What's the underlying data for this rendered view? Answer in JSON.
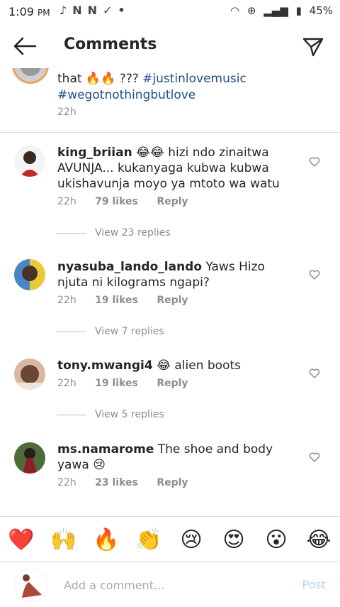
{
  "status_bar": {
    "time": "1:09",
    "ampm": "PM",
    "battery": "45%",
    "left_icons": [
      "music-note-icon",
      "n-notification-icon",
      "n-notification-icon",
      "download-done-icon",
      "dot-icon"
    ],
    "right_icons": [
      "headphones-icon",
      "data-saver-icon",
      "signal-icon",
      "battery-icon"
    ]
  },
  "header": {
    "title": "Comments",
    "back_icon": "back-arrow-icon",
    "send_icon": "send-icon"
  },
  "caption": {
    "text_prefix": "that 🔥🔥 ??? ",
    "hashtag1": "#justinlovemusic",
    "hashtag2": "#wegotnothingbutlove",
    "time": "22h"
  },
  "comments": [
    {
      "username": "king_briian",
      "text": "😂😂 hizi ndo zinaitwa AVUNJA... kukanyaga kubwa kubwa ukishavunja moyo ya mtoto wa watu",
      "time": "22h",
      "likes": "79 likes",
      "reply": "Reply",
      "view_replies": "View 23 replies"
    },
    {
      "username": "nyasuba_lando_lando",
      "text": "Yaws Hizo njuta ni kilograms ngapi?",
      "time": "22h",
      "likes": "19 likes",
      "reply": "Reply",
      "view_replies": "View 7 replies"
    },
    {
      "username": "tony.mwangi4",
      "text": "😂 alien boots",
      "time": "22h",
      "likes": "19 likes",
      "reply": "Reply",
      "view_replies": "View 5 replies"
    },
    {
      "username": "ms.namarome",
      "text": "The shoe and body yawa 😢",
      "time": "22h",
      "likes": "23 likes",
      "reply": "Reply"
    }
  ],
  "emoji_bar": [
    "❤️",
    "🙌",
    "🔥",
    "👏",
    "😢",
    "😍",
    "😮",
    "😂"
  ],
  "input": {
    "placeholder": "Add a comment...",
    "post_label": "Post"
  },
  "colors": {
    "hashtag": "#1f4f86",
    "secondary_text": "#8e8e8e",
    "post_disabled": "#b3d4fa",
    "divider": "#dbdbdb"
  }
}
